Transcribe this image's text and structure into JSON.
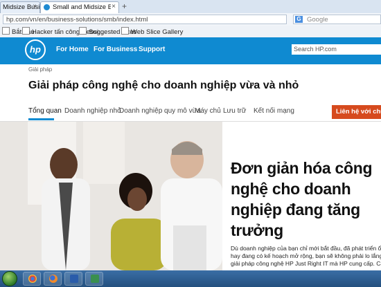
{
  "browser": {
    "tabs": [
      {
        "title": "Midsize Business...",
        "active": false
      },
      {
        "title": "Small and Midsize Business...",
        "active": true
      }
    ],
    "new_tab_glyph": "+",
    "close_glyph": "×",
    "url": "hp.com/vn/en/business-solutions/smb/index.html",
    "search_engine": "Google",
    "search_engine_icon": "G",
    "bookmarks": [
      {
        "label": "Bắt đầu"
      },
      {
        "label": "Hacker tấn công websi..."
      },
      {
        "label": "Suggested Sites"
      },
      {
        "label": "Web Slice Gallery"
      }
    ]
  },
  "header": {
    "logo_text": "hp",
    "nav": [
      "For Home",
      "For Business",
      "Support"
    ],
    "search_placeholder": "Search HP.com",
    "brand_color": "#0f8ad1"
  },
  "page": {
    "breadcrumb": "Giải pháp",
    "title": "Giải pháp công nghệ cho doanh nghiệp vừa và nhỏ",
    "tabs": [
      "Tổng quan",
      "Doanh nghiệp nhỏ",
      "Doanh nghiệp quy mô vừa",
      "Máy chủ",
      "Lưu trữ",
      "Kết nối mạng"
    ],
    "active_tab": "Tổng quan",
    "contact_button": "Liên hệ với chúng",
    "contact_color": "#d64a1e"
  },
  "hero": {
    "headline": "Đơn giản hóa công nghệ cho doanh nghiệp đang tăng trưởng",
    "body_lines": [
      "Dù doanh nghiệp của bạn chỉ mới bắt đầu, đã phát triển ổn đ",
      "hay đang có kế hoạch mở rộng, bạn sẽ không phải lo lắng nh",
      "giải pháp công nghệ HP Just Right IT mà HP cung cấp. Các giả"
    ]
  },
  "taskbar": {
    "items": [
      "start-orb-icon",
      "chrome-icon",
      "firefox-icon",
      "word-icon",
      "app-icon"
    ]
  }
}
